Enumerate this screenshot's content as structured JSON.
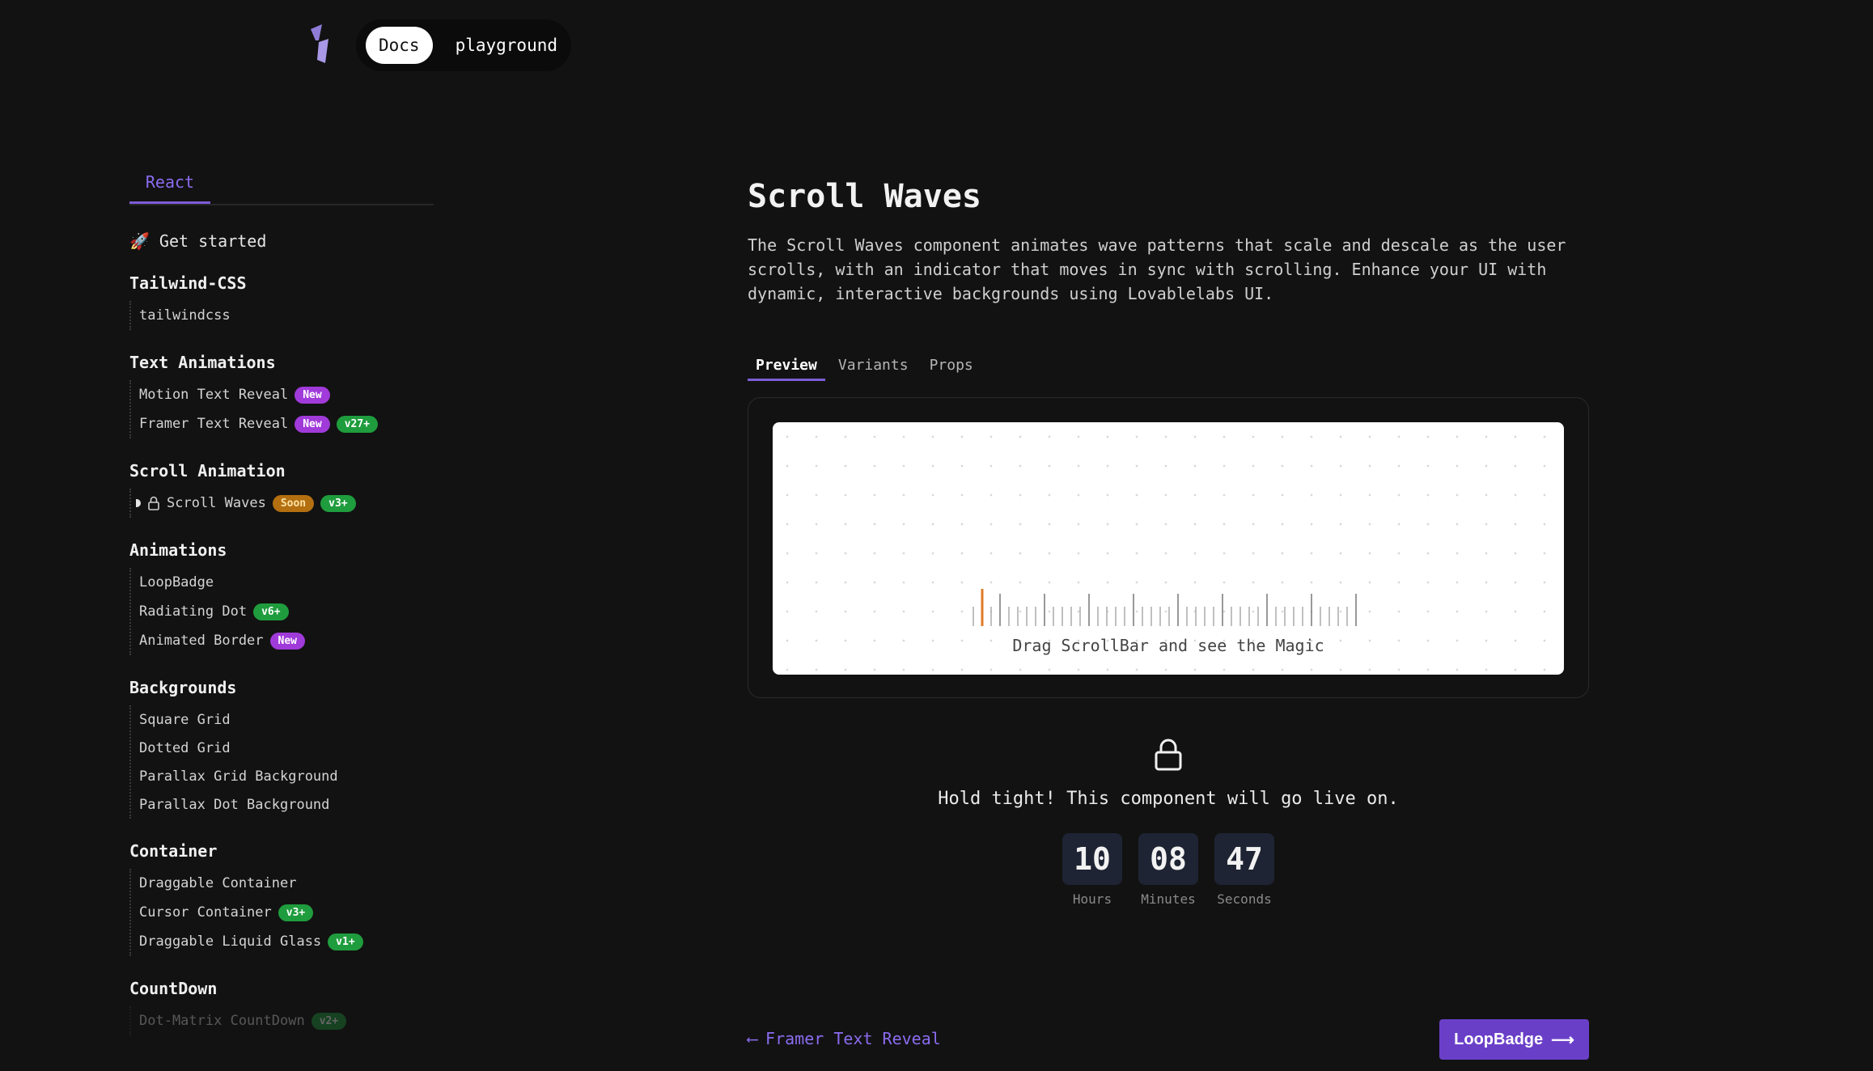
{
  "topnav": {
    "docs": "Docs",
    "playground": "playground"
  },
  "sidebar": {
    "tab": "React",
    "get_started": {
      "icon": "rocket-icon",
      "label": "Get started"
    },
    "sections": [
      {
        "title": "Tailwind-CSS",
        "items": [
          {
            "label": "tailwindcss"
          }
        ]
      },
      {
        "title": "Text Animations",
        "items": [
          {
            "label": "Motion Text Reveal",
            "badges": [
              "New"
            ]
          },
          {
            "label": "Framer Text Reveal",
            "badges": [
              "New",
              "v27+"
            ]
          }
        ]
      },
      {
        "title": "Scroll Animation",
        "items": [
          {
            "label": "Scroll Waves",
            "badges": [
              "Soon",
              "v3+"
            ]
          }
        ]
      },
      {
        "title": "Animations",
        "items": [
          {
            "label": "LoopBadge"
          },
          {
            "label": "Radiating Dot",
            "badges": [
              "v6+"
            ]
          },
          {
            "label": "Animated Border",
            "badges": [
              "New"
            ]
          }
        ]
      },
      {
        "title": "Backgrounds",
        "items": [
          {
            "label": "Square Grid"
          },
          {
            "label": "Dotted Grid"
          },
          {
            "label": "Parallax Grid Background"
          },
          {
            "label": "Parallax Dot Background"
          }
        ]
      },
      {
        "title": "Container",
        "items": [
          {
            "label": "Draggable Container"
          },
          {
            "label": "Cursor Container",
            "badges": [
              "v3+"
            ]
          },
          {
            "label": "Draggable Liquid Glass",
            "badges": [
              "v1+"
            ]
          }
        ]
      },
      {
        "title": "CountDown",
        "items": [
          {
            "label": "Dot-Matrix CountDown",
            "badges": [
              "v2+"
            ]
          }
        ]
      }
    ]
  },
  "main": {
    "title": "Scroll Waves",
    "description": "The Scroll Waves component animates wave patterns that scale and descale as the user scrolls, with an indicator that moves in sync with scrolling. Enhance your UI with dynamic, interactive backgrounds using Lovablelabs UI.",
    "tabs": [
      "Preview",
      "Variants",
      "Props"
    ],
    "preview_caption": "Drag ScrollBar and see the Magic",
    "hold_text": "Hold tight! This component will go live on.",
    "countdown": [
      {
        "value": "10",
        "label": "Hours"
      },
      {
        "value": "08",
        "label": "Minutes"
      },
      {
        "value": "47",
        "label": "Seconds"
      }
    ]
  },
  "pagination": {
    "prev_label": "Framer Text Reveal",
    "next_label": "LoopBadge"
  },
  "colors": {
    "accent": "#7c5cd6",
    "badge_new": "#a03ad9",
    "badge_version": "#1f9c3d",
    "badge_soon": "#b46f10",
    "indicator": "#e07b28"
  }
}
